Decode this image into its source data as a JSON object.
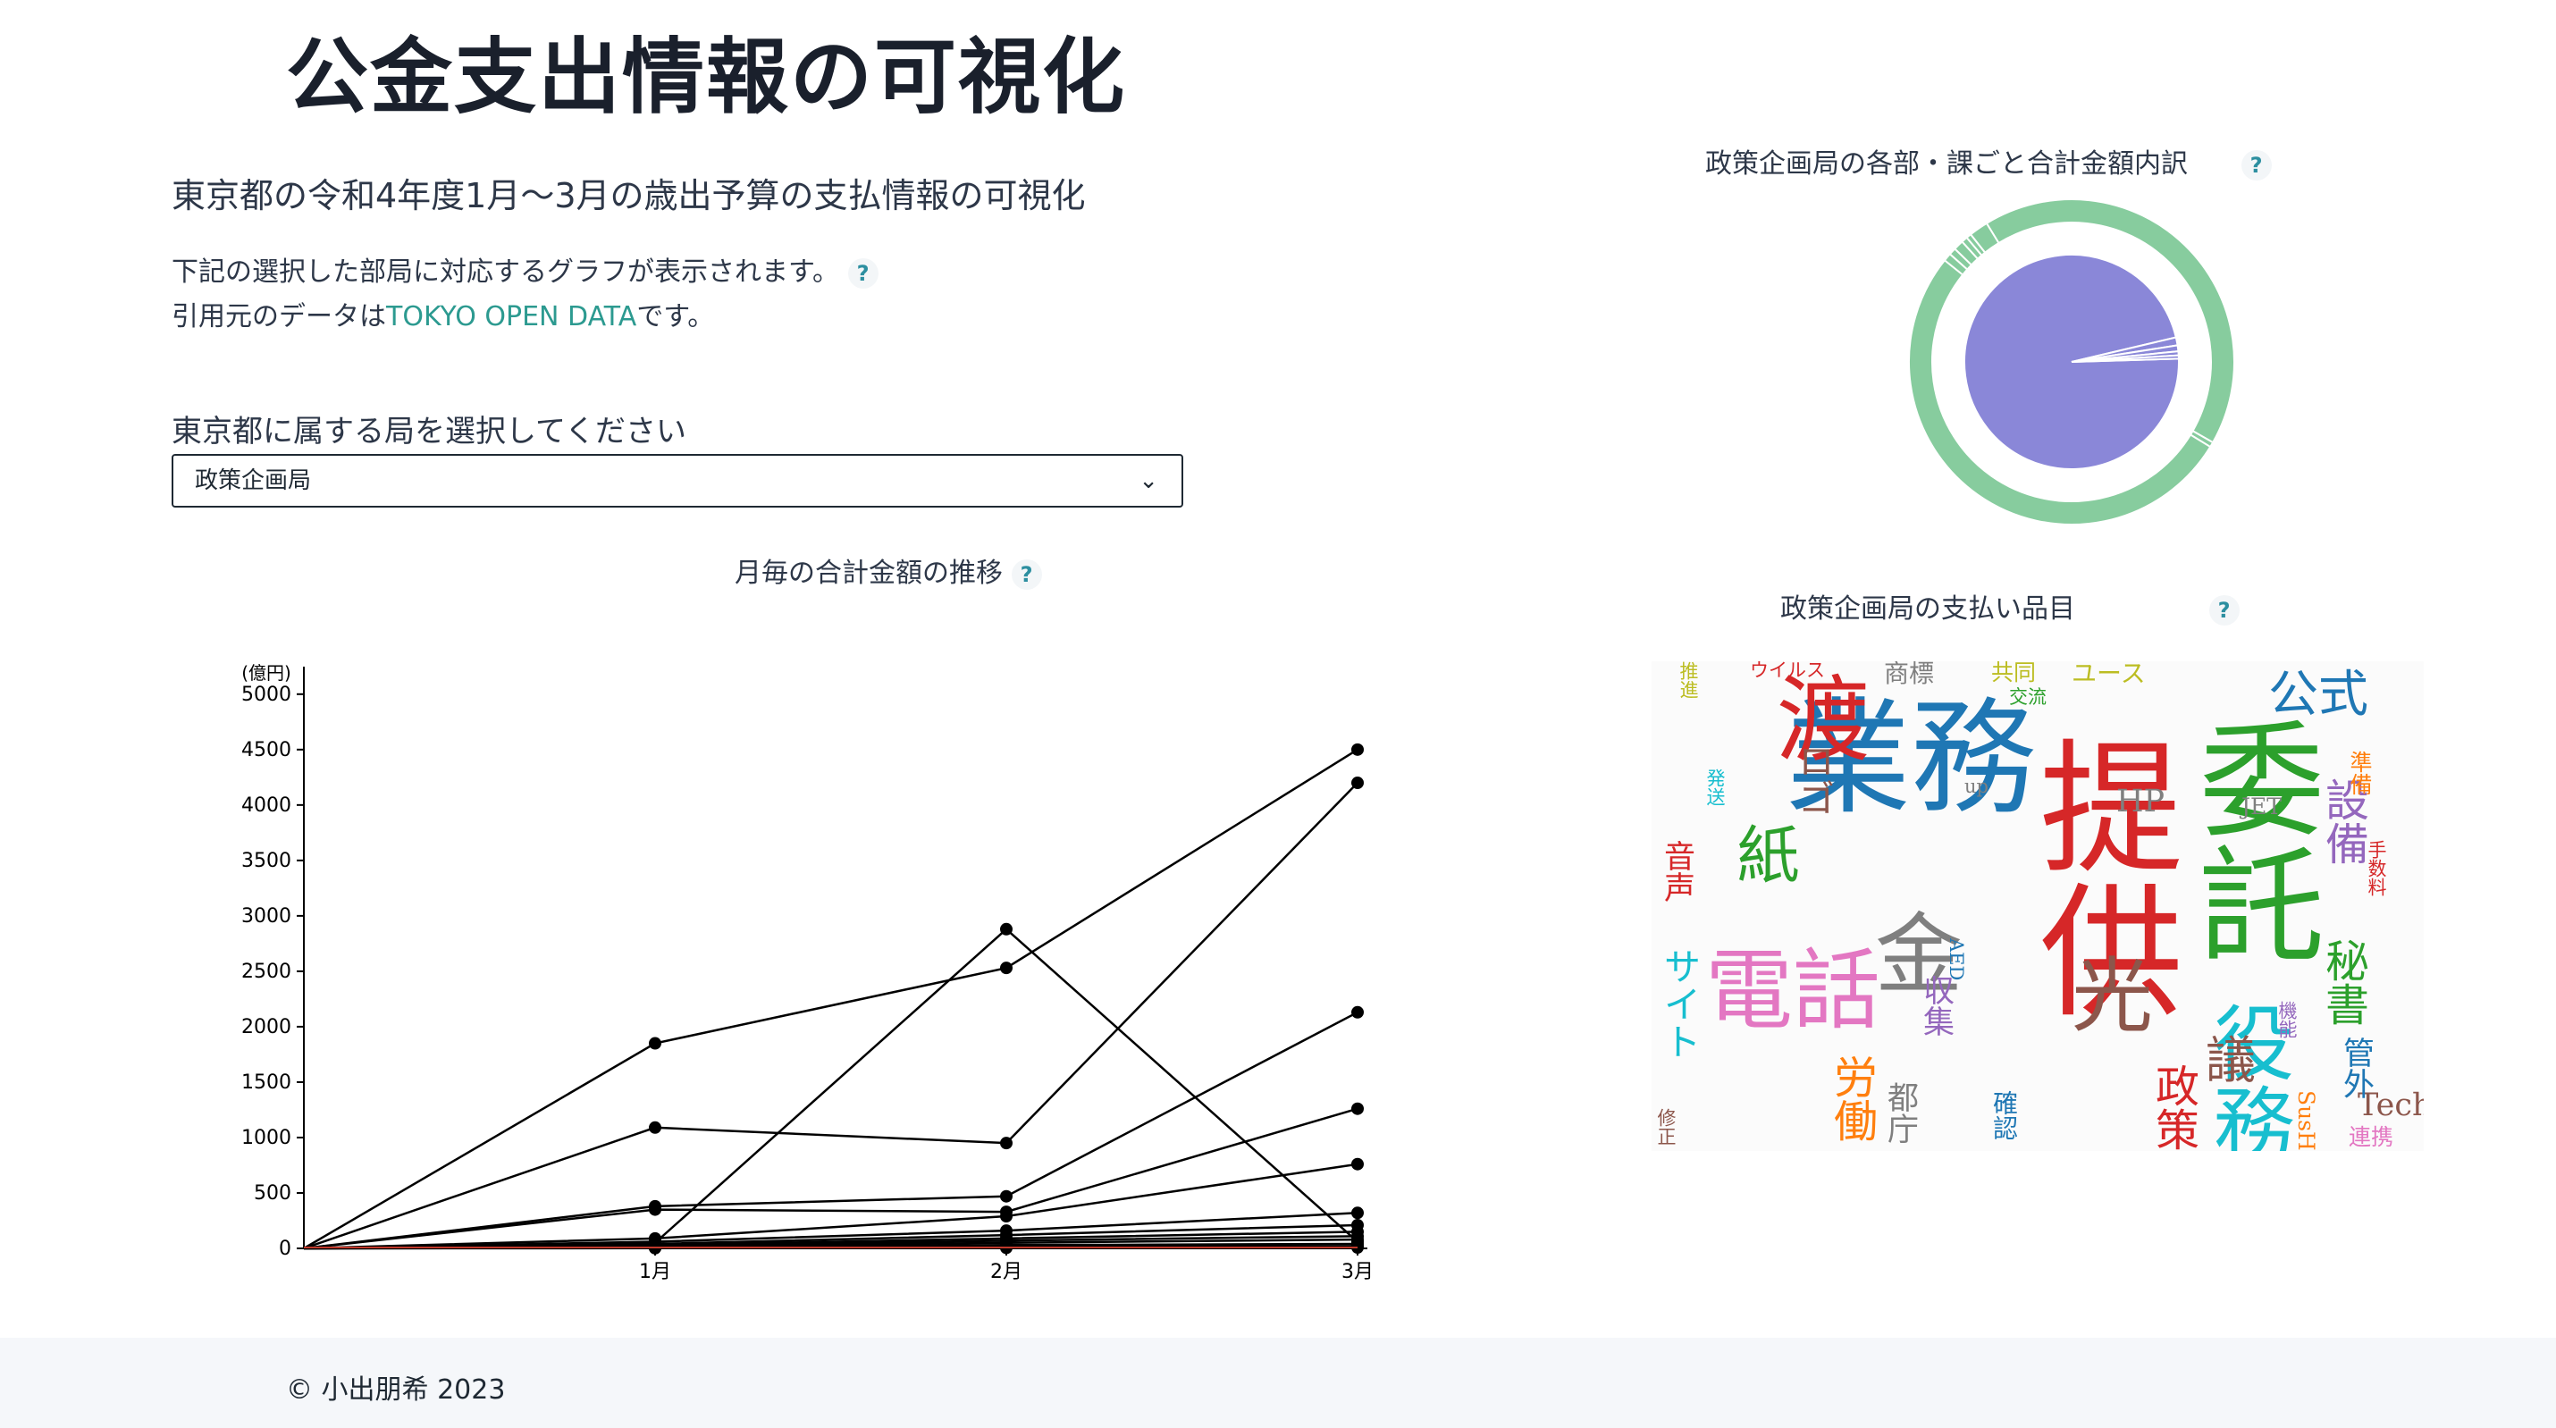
{
  "page": {
    "title": "公金支出情報の可視化",
    "subtitle": "東京都の令和4年度1月〜3月の歳出予算の支払情報の可視化",
    "desc_line1": "下記の選択した部局に対応するグラフが表示されます。",
    "desc_line2_prefix": "引用元のデータは",
    "desc_link": "TOKYO OPEN DATA",
    "desc_line2_suffix": "です。",
    "help_icon": "?",
    "select_label": "東京都に属する局を選択してください",
    "select_value": "政策企画局",
    "select_chevron": "⌄",
    "footer": "© 小出朋希 2023"
  },
  "line_title": "月毎の合計金額の推移",
  "pie_title": "政策企画局の各部・課ごと合計金額内訳",
  "wordcloud_title": "政策企画局の支払い品目",
  "colors": {
    "line": "#000000",
    "pie_inner": "#8a87d8",
    "pie_outer": "#87cc9e",
    "link": "#2c9a90"
  },
  "chart_data": [
    {
      "type": "line",
      "title": "月毎の合計金額の推移",
      "ylabel": "(億円)",
      "categories": [
        "",
        "1月",
        "2月",
        "3月"
      ],
      "yticks": [
        "0",
        "500",
        "1000",
        "1500",
        "2000",
        "2500",
        "3000",
        "3500",
        "4000",
        "4500",
        "5000"
      ],
      "ylim": [
        0,
        5200
      ],
      "series": [
        {
          "values": [
            0,
            1850,
            2530,
            4500
          ]
        },
        {
          "values": [
            0,
            50,
            2880,
            60
          ]
        },
        {
          "values": [
            0,
            1090,
            950,
            4200
          ]
        },
        {
          "values": [
            0,
            380,
            470,
            2130
          ]
        },
        {
          "values": [
            0,
            350,
            330,
            1260
          ]
        },
        {
          "values": [
            0,
            90,
            290,
            760
          ]
        },
        {
          "values": [
            0,
            60,
            160,
            320
          ]
        },
        {
          "values": [
            0,
            40,
            120,
            210
          ]
        },
        {
          "values": [
            0,
            30,
            90,
            150
          ]
        },
        {
          "values": [
            0,
            20,
            70,
            110
          ]
        },
        {
          "values": [
            0,
            15,
            50,
            80
          ]
        },
        {
          "values": [
            0,
            10,
            30,
            40
          ]
        },
        {
          "values": [
            0,
            5,
            15,
            20
          ]
        },
        {
          "values": [
            0,
            2,
            5,
            8
          ]
        }
      ]
    },
    {
      "type": "pie",
      "title": "政策企画局の各部・課ごと合計金額内訳",
      "inner_slices": [
        96.8,
        1.2,
        0.9,
        0.6,
        0.5
      ],
      "outer_slices": [
        42.0,
        0.5,
        52.0,
        0.8,
        0.7,
        1.0,
        0.6,
        0.5,
        1.9
      ]
    }
  ],
  "wordcloud": {
    "words": [
      {
        "t": "業務",
        "c": "#1f77b4",
        "s": 2.0
      },
      {
        "t": "提供",
        "c": "#d62728",
        "s": 2.3
      },
      {
        "t": "委託",
        "c": "#2ca02c",
        "s": 2.0
      },
      {
        "t": "電話",
        "c": "#e377c2",
        "s": 1.4
      },
      {
        "t": "渡",
        "c": "#d62728",
        "s": 1.5
      },
      {
        "t": "金",
        "c": "#7f7f7f",
        "s": 1.4
      },
      {
        "t": "役務",
        "c": "#17becf",
        "s": 1.3
      },
      {
        "t": "光",
        "c": "#8c564b",
        "s": 1.3
      },
      {
        "t": "紙",
        "c": "#2ca02c",
        "s": 1.0
      },
      {
        "t": "公式",
        "c": "#1f77b4",
        "s": 0.8
      },
      {
        "t": "設備",
        "c": "#9467bd",
        "s": 0.7
      },
      {
        "t": "秘書",
        "c": "#2ca02c",
        "s": 0.7
      },
      {
        "t": "議",
        "c": "#8c564b",
        "s": 0.8
      },
      {
        "t": "政策",
        "c": "#d62728",
        "s": 0.7
      },
      {
        "t": "労働",
        "c": "#ff7f0e",
        "s": 0.7
      },
      {
        "t": "サイト",
        "c": "#17becf",
        "s": 0.6
      },
      {
        "t": "ロゴ",
        "c": "#8c564b",
        "s": 0.6
      },
      {
        "t": "Tech",
        "c": "#8c564b",
        "s": 0.5
      },
      {
        "t": "収集",
        "c": "#9467bd",
        "s": 0.5
      },
      {
        "t": "都庁",
        "c": "#7f7f7f",
        "s": 0.5
      },
      {
        "t": "音声",
        "c": "#d62728",
        "s": 0.5
      },
      {
        "t": "管外",
        "c": "#1f77b4",
        "s": 0.5
      },
      {
        "t": "商標",
        "c": "#7f7f7f",
        "s": 0.4
      },
      {
        "t": "確認",
        "c": "#1f77b4",
        "s": 0.4
      },
      {
        "t": "連携",
        "c": "#e377c2",
        "s": 0.35
      },
      {
        "t": "HP",
        "c": "#7f7f7f",
        "s": 0.5
      },
      {
        "t": "SusHi",
        "c": "#ff7f0e",
        "s": 0.35
      },
      {
        "t": "JET",
        "c": "#7f7f7f",
        "s": 0.35
      },
      {
        "t": "ユース",
        "c": "#bcbd22",
        "s": 0.4
      },
      {
        "t": "共同",
        "c": "#bcbd22",
        "s": 0.35
      },
      {
        "t": "AED",
        "c": "#1f77b4",
        "s": 0.3
      },
      {
        "t": "ウイルス",
        "c": "#d62728",
        "s": 0.3
      },
      {
        "t": "交流",
        "c": "#2ca02c",
        "s": 0.3
      },
      {
        "t": "準備",
        "c": "#ff7f0e",
        "s": 0.35
      },
      {
        "t": "手数料",
        "c": "#d62728",
        "s": 0.3
      },
      {
        "t": "修正",
        "c": "#8c564b",
        "s": 0.3
      },
      {
        "t": "up",
        "c": "#7f7f7f",
        "s": 0.3
      },
      {
        "t": "発送",
        "c": "#17becf",
        "s": 0.3
      },
      {
        "t": "機能",
        "c": "#9467bd",
        "s": 0.3
      },
      {
        "t": "推進",
        "c": "#bcbd22",
        "s": 0.3
      }
    ]
  }
}
